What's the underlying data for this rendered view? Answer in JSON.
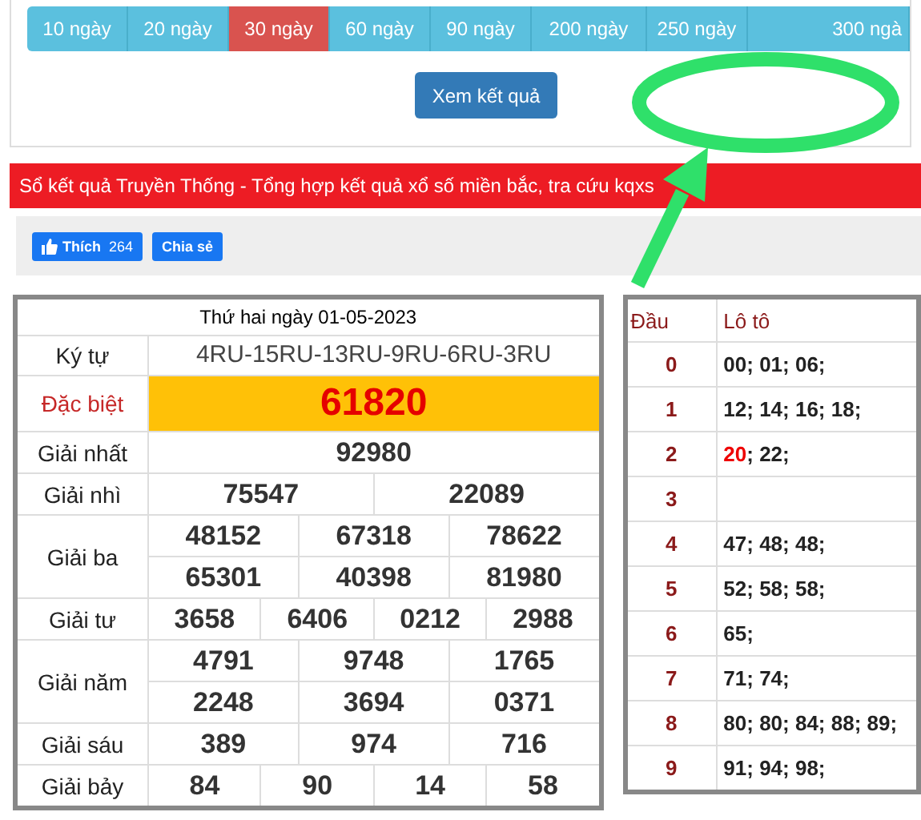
{
  "tabs": [
    {
      "label": "10 ngày",
      "selected": false
    },
    {
      "label": "20 ngày",
      "selected": false
    },
    {
      "label": "30 ngày",
      "selected": true
    },
    {
      "label": "60 ngày",
      "selected": false
    },
    {
      "label": "90 ngày",
      "selected": false
    },
    {
      "label": "200 ngày",
      "selected": false
    },
    {
      "label": "250 ngày",
      "selected": false
    },
    {
      "label": "300 ngà",
      "selected": false
    }
  ],
  "submit_button": "Xem kết quả",
  "banner": "Sổ kết quả Truyền Thống - Tổng hợp kết quả xổ số miền bắc, tra cứu kqxs",
  "social": [
    {
      "kind": "like",
      "label": "Thích",
      "count": "264"
    },
    {
      "kind": "share",
      "label": "Chia sẻ"
    }
  ],
  "results": {
    "date": "Thứ hai ngày 01-05-2023",
    "rows": [
      {
        "label": "Ký tự",
        "kind": "code",
        "lines": [
          [
            "4RU-15RU-13RU-9RU-6RU-3RU"
          ]
        ]
      },
      {
        "label": "Đặc biệt",
        "kind": "special",
        "lines": [
          [
            "61820"
          ]
        ]
      },
      {
        "label": "Giải nhất",
        "kind": "prize",
        "lines": [
          [
            "92980"
          ]
        ]
      },
      {
        "label": "Giải nhì",
        "kind": "prize",
        "lines": [
          [
            "75547",
            "22089"
          ]
        ]
      },
      {
        "label": "Giải ba",
        "kind": "prize",
        "lines": [
          [
            "48152",
            "67318",
            "78622"
          ],
          [
            "65301",
            "40398",
            "81980"
          ]
        ]
      },
      {
        "label": "Giải tư",
        "kind": "prize",
        "lines": [
          [
            "3658",
            "6406",
            "0212",
            "2988"
          ]
        ]
      },
      {
        "label": "Giải năm",
        "kind": "prize",
        "lines": [
          [
            "4791",
            "9748",
            "1765"
          ],
          [
            "2248",
            "3694",
            "0371"
          ]
        ]
      },
      {
        "label": "Giải sáu",
        "kind": "prize",
        "lines": [
          [
            "389",
            "974",
            "716"
          ]
        ]
      },
      {
        "label": "Giải bảy",
        "kind": "prize",
        "lines": [
          [
            "84",
            "90",
            "14",
            "58"
          ]
        ]
      }
    ]
  },
  "loto": {
    "columns": [
      "Đầu",
      "Lô tô"
    ],
    "rows": [
      {
        "head": "0",
        "segments": [
          {
            "text": "00; 01; 06;",
            "hot": false
          }
        ]
      },
      {
        "head": "1",
        "segments": [
          {
            "text": "12; 14; 16; 18;",
            "hot": false
          }
        ]
      },
      {
        "head": "2",
        "segments": [
          {
            "text": "20",
            "hot": true
          },
          {
            "text": "; 22;",
            "hot": false
          }
        ]
      },
      {
        "head": "3",
        "segments": []
      },
      {
        "head": "4",
        "segments": [
          {
            "text": "47; 48; 48;",
            "hot": false
          }
        ]
      },
      {
        "head": "5",
        "segments": [
          {
            "text": "52; 58; 58;",
            "hot": false
          }
        ]
      },
      {
        "head": "6",
        "segments": [
          {
            "text": "65;",
            "hot": false
          }
        ]
      },
      {
        "head": "7",
        "segments": [
          {
            "text": "71; 74;",
            "hot": false
          }
        ]
      },
      {
        "head": "8",
        "segments": [
          {
            "text": "80; 80; 84; 88; 89;",
            "hot": false
          }
        ]
      },
      {
        "head": "9",
        "segments": [
          {
            "text": "91; 94; 98;",
            "hot": false
          }
        ]
      }
    ]
  }
}
